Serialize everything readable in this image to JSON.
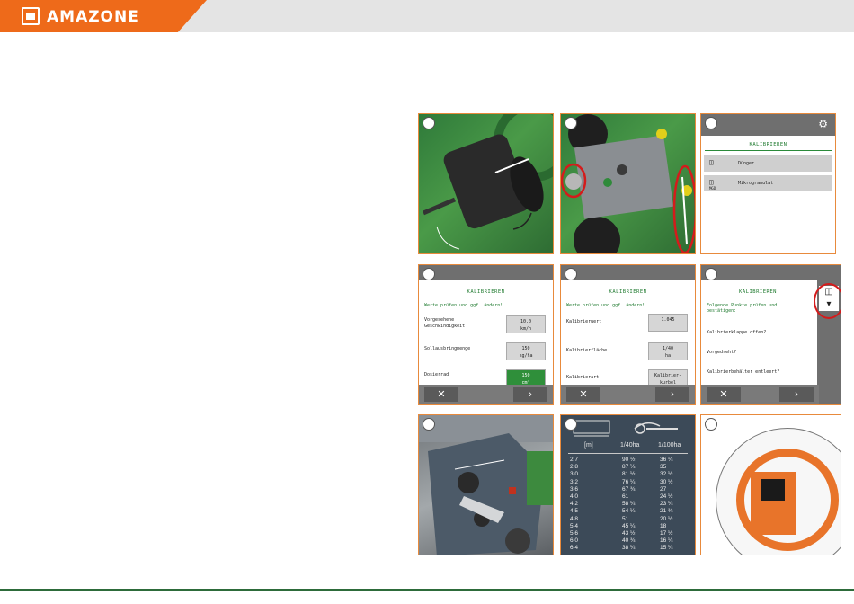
{
  "header": {
    "brand": "AMAZONE"
  },
  "colors": {
    "brand_orange": "#ee6a1a",
    "amazone_green": "#2f8f3a",
    "highlight_red": "#d41c1c",
    "panel_border": "#e88a3c"
  },
  "panels": {
    "p1": {
      "num": ""
    },
    "p2": {
      "num": ""
    },
    "p3": {
      "num": "",
      "title": "KALIBRIEREN",
      "items": [
        {
          "icon": "hopper-icon",
          "label": "Dünger"
        },
        {
          "icon": "hopper-icon",
          "label": "Mikrogranulat",
          "sub": "MGD"
        }
      ]
    },
    "p4": {
      "num": "",
      "title": "KALIBRIEREN",
      "subtitle": "Werte prüfen und ggf. ändern!",
      "rows": [
        {
          "label": "Vorgesehene Geschwindigkeit",
          "value": "10.0",
          "unit": "km/h"
        },
        {
          "label": "Sollausbringmenge",
          "value": "150",
          "unit": "kg/ha"
        },
        {
          "label": "Dosierrad",
          "value": "150",
          "unit": "cm³"
        }
      ]
    },
    "p5": {
      "num": "",
      "title": "KALIBRIEREN",
      "subtitle": "Werte prüfen und ggf. ändern!",
      "rows": [
        {
          "label": "Kalibrierwert",
          "value": "1.045",
          "unit": ""
        },
        {
          "label": "Kalibrierfläche",
          "value": "1/40",
          "unit": "ha"
        },
        {
          "label": "Kalibrierart",
          "value": "Kalibrier-",
          "unit": "kurbel"
        }
      ]
    },
    "p6": {
      "num": "",
      "title": "KALIBRIEREN",
      "subtitle": "Folgende Punkte prüfen und bestätigen:",
      "checks": [
        "Kalibrierklappe offen?",
        "Vorgedreht?",
        "Kalibrierbehälter entleert?"
      ]
    },
    "p7": {
      "num": ""
    },
    "p8": {
      "num": "",
      "headers": [
        "[m]",
        "1/40ha",
        "1/100ha"
      ],
      "rows": [
        [
          "2,7",
          "90 ½",
          "36 ¼"
        ],
        [
          "2,8",
          "87 ¼",
          "35"
        ],
        [
          "3,0",
          "81 ½",
          "32 ½"
        ],
        [
          "3,2",
          "76 ¼",
          "30 ½"
        ],
        [
          "3,6",
          "67 ¾",
          "27"
        ],
        [
          "4,0",
          "61",
          "24 ½"
        ],
        [
          "4,2",
          "58 ¼",
          "23 ¼"
        ],
        [
          "4,5",
          "54 ¼",
          "21 ¾"
        ],
        [
          "4,8",
          "51",
          "20 ½"
        ],
        [
          "5,4",
          "45 ¼",
          "18"
        ],
        [
          "5,6",
          "43 ½",
          "17 ½"
        ],
        [
          "6,0",
          "40 ¾",
          "16 ¼"
        ],
        [
          "6,4",
          "38 ¼",
          "15 ¼"
        ]
      ]
    },
    "p9": {
      "num": ""
    }
  },
  "buttons": {
    "cancel": "✕",
    "next": "›"
  }
}
